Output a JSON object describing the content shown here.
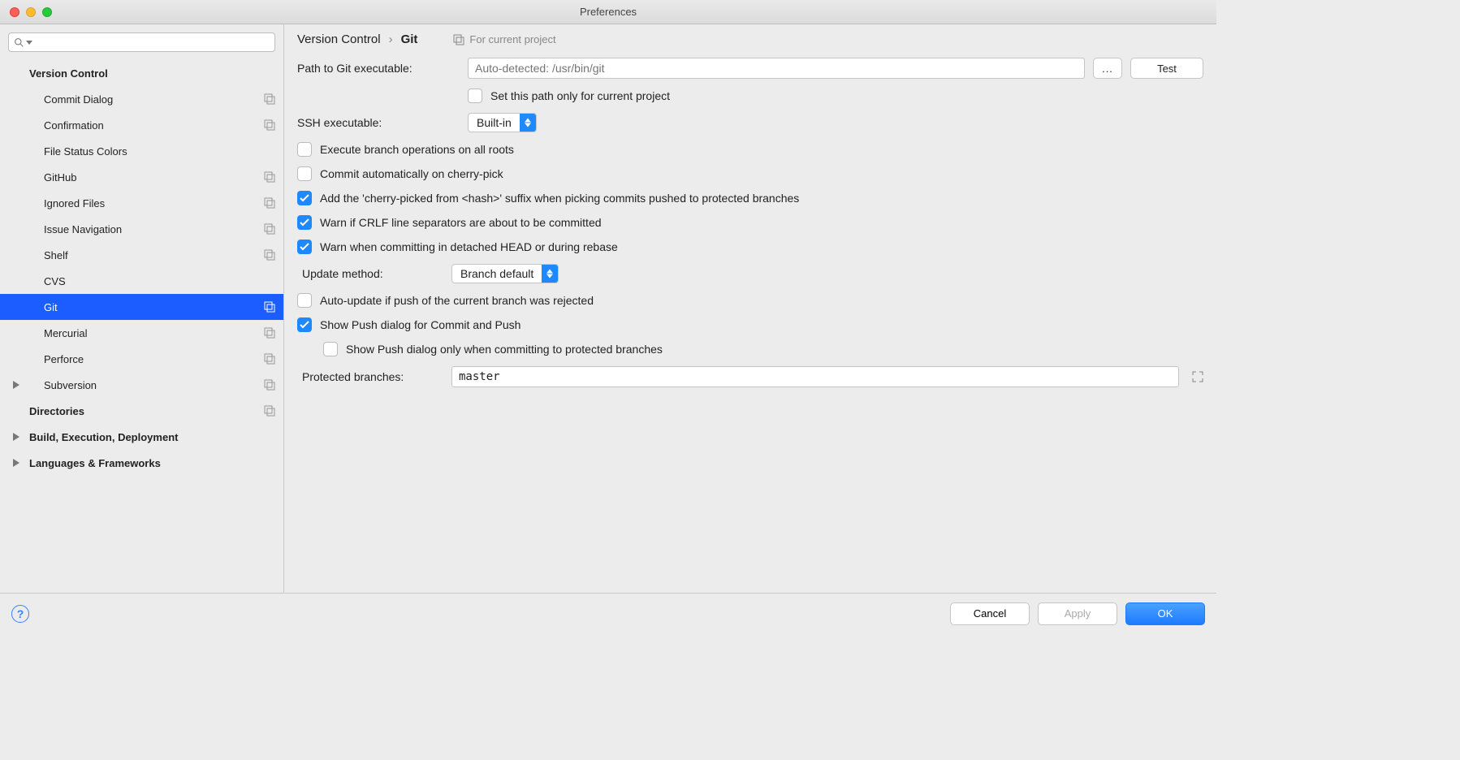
{
  "window": {
    "title": "Preferences"
  },
  "sidebar": {
    "groups": [
      {
        "label": "Version Control",
        "bold": true,
        "arrow": false,
        "scope": false,
        "items": [
          {
            "label": "Commit Dialog",
            "scope": true
          },
          {
            "label": "Confirmation",
            "scope": true
          },
          {
            "label": "File Status Colors",
            "scope": false
          },
          {
            "label": "GitHub",
            "scope": true
          },
          {
            "label": "Ignored Files",
            "scope": true
          },
          {
            "label": "Issue Navigation",
            "scope": true
          },
          {
            "label": "Shelf",
            "scope": true
          },
          {
            "label": "CVS",
            "scope": false
          },
          {
            "label": "Git",
            "scope": true,
            "selected": true
          },
          {
            "label": "Mercurial",
            "scope": true
          },
          {
            "label": "Perforce",
            "scope": true
          },
          {
            "label": "Subversion",
            "scope": true,
            "arrow": true
          }
        ]
      },
      {
        "label": "Directories",
        "bold": true,
        "arrow": false,
        "scope": true,
        "items": []
      },
      {
        "label": "Build, Execution, Deployment",
        "bold": true,
        "arrow": true,
        "scope": false,
        "items": []
      },
      {
        "label": "Languages & Frameworks",
        "bold": true,
        "arrow": true,
        "scope": false,
        "items": []
      }
    ]
  },
  "breadcrumb": {
    "root": "Version Control",
    "leaf": "Git",
    "sep": "›"
  },
  "scope_label": "For current project",
  "form": {
    "path_label": "Path to Git executable:",
    "path_placeholder": "Auto-detected: /usr/bin/git",
    "browse": "...",
    "test": "Test",
    "ssh_label": "SSH executable:",
    "ssh_value": "Built-in",
    "update_label": "Update method:",
    "update_value": "Branch default",
    "protected_label": "Protected branches:",
    "protected_value": "master",
    "checks": {
      "c1": {
        "label": "Set this path only for current project",
        "checked": false,
        "indentLabel": true
      },
      "c2": {
        "label": "Execute branch operations on all roots",
        "checked": false
      },
      "c3": {
        "label": "Commit automatically on cherry-pick",
        "checked": false
      },
      "c4": {
        "label": "Add the 'cherry-picked from <hash>' suffix when picking commits pushed to protected branches",
        "checked": true
      },
      "c5": {
        "label": "Warn if CRLF line separators are about to be committed",
        "checked": true
      },
      "c6": {
        "label": "Warn when committing in detached HEAD or during rebase",
        "checked": true
      },
      "c7": {
        "label": "Auto-update if push of the current branch was rejected",
        "checked": false
      },
      "c8": {
        "label": "Show Push dialog for Commit and Push",
        "checked": true
      },
      "c9": {
        "label": "Show Push dialog only when committing to protected branches",
        "checked": false
      }
    }
  },
  "footer": {
    "cancel": "Cancel",
    "apply": "Apply",
    "ok": "OK"
  }
}
